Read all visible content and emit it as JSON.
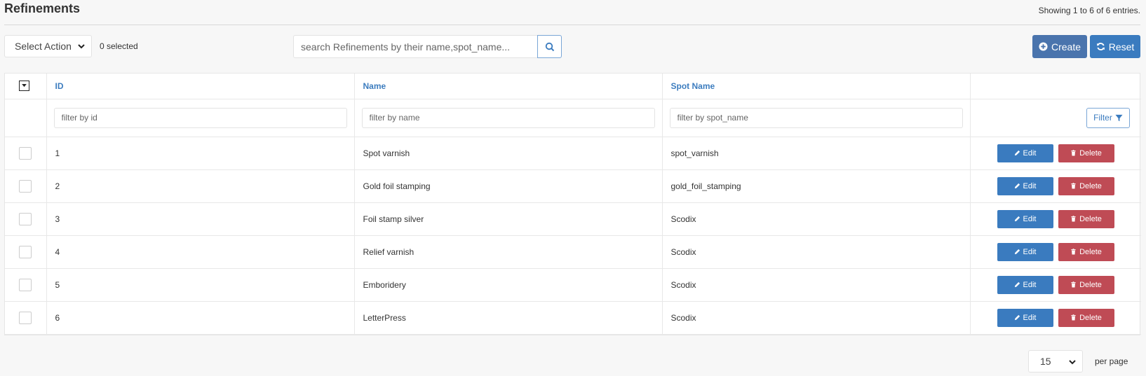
{
  "page": {
    "title": "Refinements",
    "entries_info": "Showing 1 to 6 of 6 entries."
  },
  "toolbar": {
    "action_select": "Select Action",
    "selected_count": "0 selected",
    "search_placeholder": "search Refinements by their name,spot_name...",
    "create_label": "Create",
    "reset_label": "Reset"
  },
  "table": {
    "columns": [
      "ID",
      "Name",
      "Spot Name"
    ],
    "filters": {
      "id_placeholder": "filter by id",
      "name_placeholder": "filter by name",
      "spot_name_placeholder": "filter by spot_name",
      "filter_label": "Filter"
    },
    "rows": [
      {
        "id": "1",
        "name": "Spot varnish",
        "spot_name": "spot_varnish"
      },
      {
        "id": "2",
        "name": "Gold foil stamping",
        "spot_name": "gold_foil_stamping"
      },
      {
        "id": "3",
        "name": "Foil stamp silver",
        "spot_name": "Scodix"
      },
      {
        "id": "4",
        "name": "Relief varnish",
        "spot_name": "Scodix"
      },
      {
        "id": "5",
        "name": "Emboridery",
        "spot_name": "Scodix"
      },
      {
        "id": "6",
        "name": "LetterPress",
        "spot_name": "Scodix"
      }
    ],
    "edit_label": "Edit",
    "delete_label": "Delete"
  },
  "pagination": {
    "per_page_value": "15",
    "per_page_label": "per page"
  },
  "colors": {
    "primary": "#3a7bbf",
    "create": "#4a74ad",
    "danger": "#bf4b55",
    "header_text": "#3d7dbf"
  }
}
